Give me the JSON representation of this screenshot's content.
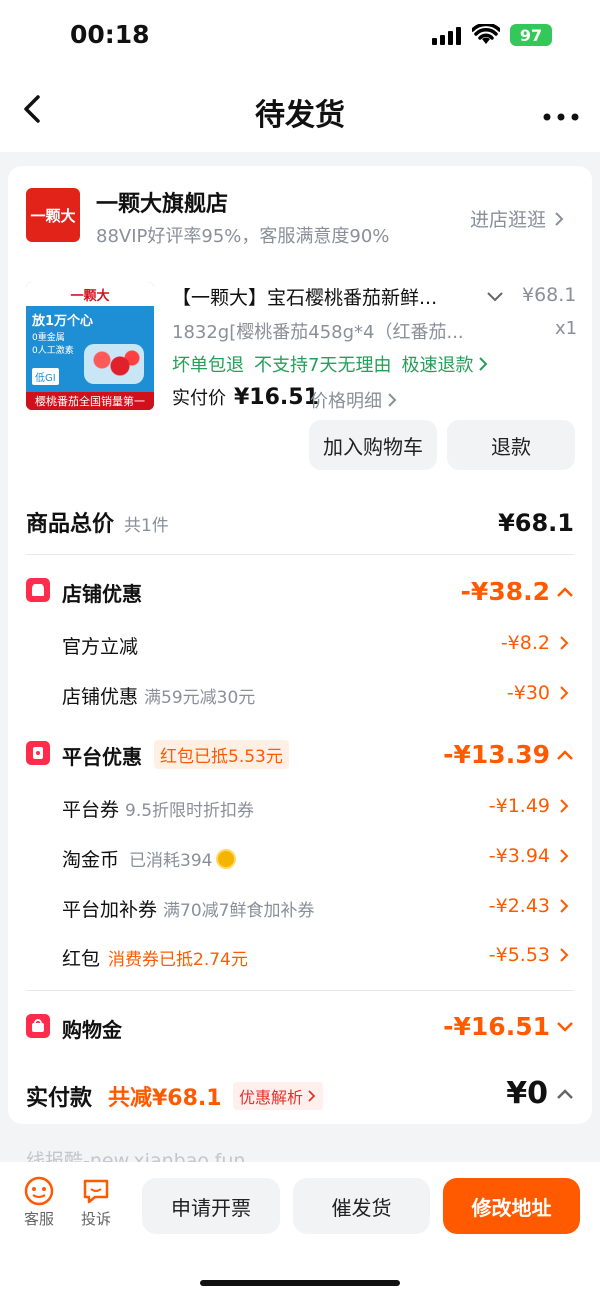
{
  "status_bar": {
    "time": "00:18",
    "battery": "97"
  },
  "nav": {
    "title": "待发货"
  },
  "store": {
    "logo_text": "一颗大",
    "name": "一颗大旗舰店",
    "rating": "88VIP好评率95%，客服满意度90%",
    "enter_label": "进店逛逛"
  },
  "product": {
    "thumb_brand": "一颗大",
    "thumb_line1": "放1万个心",
    "thumb_line2": "0重金属",
    "thumb_line3": "0人工激素",
    "thumb_tag": "低GI",
    "thumb_bottom": "樱桃番茄全国销量第一",
    "title": "【一颗大】宝石樱桃番茄新鲜...",
    "price": "¥68.1",
    "spec": "1832g[樱桃番茄458g*4（红番茄...",
    "qty": "x1",
    "tag1": "坏单包退",
    "tag2": "不支持7天无理由",
    "tag3": "极速退款",
    "paid_label": "实付价",
    "paid_value": "¥16.51",
    "detail_label": "价格明细",
    "add_cart": "加入购物车",
    "refund": "退款"
  },
  "summary": {
    "total_label": "商品总价",
    "total_count": "共1件",
    "total_value": "¥68.1",
    "store_discount": {
      "label": "店铺优惠",
      "value": "-¥38.2"
    },
    "official": {
      "label": "官方立减",
      "value": "-¥8.2"
    },
    "shop_coupon": {
      "label": "店铺优惠",
      "note": "满59元减30元",
      "value": "-¥30"
    },
    "platform": {
      "label": "平台优惠",
      "badge": "红包已抵5.53元",
      "value": "-¥13.39"
    },
    "platform_coupon": {
      "label": "平台券",
      "note": "9.5折限时折扣券",
      "value": "-¥1.49"
    },
    "gold": {
      "label": "淘金币",
      "note": "已消耗394",
      "value": "-¥3.94"
    },
    "subsidy": {
      "label": "平台加补券",
      "note": "满70减7鲜食加补券",
      "value": "-¥2.43"
    },
    "redpack": {
      "label": "红包",
      "note": "消费券已抵2.74元",
      "value": "-¥5.53"
    },
    "shopping_gold": {
      "label": "购物金",
      "value": "-¥16.51"
    },
    "actual": {
      "label": "实付款",
      "saved": "共减¥68.1",
      "analysis": "优惠解析",
      "value": "¥0"
    }
  },
  "watermark": "线报酷-new.xianbao.fun",
  "bottom": {
    "service": "客服",
    "complaint": "投诉",
    "invoice": "申请开票",
    "urge": "催发货",
    "address": "修改地址"
  },
  "colors": {
    "accent": "#ff5a00",
    "green": "#25a05a",
    "brand_red": "#e2231a"
  }
}
